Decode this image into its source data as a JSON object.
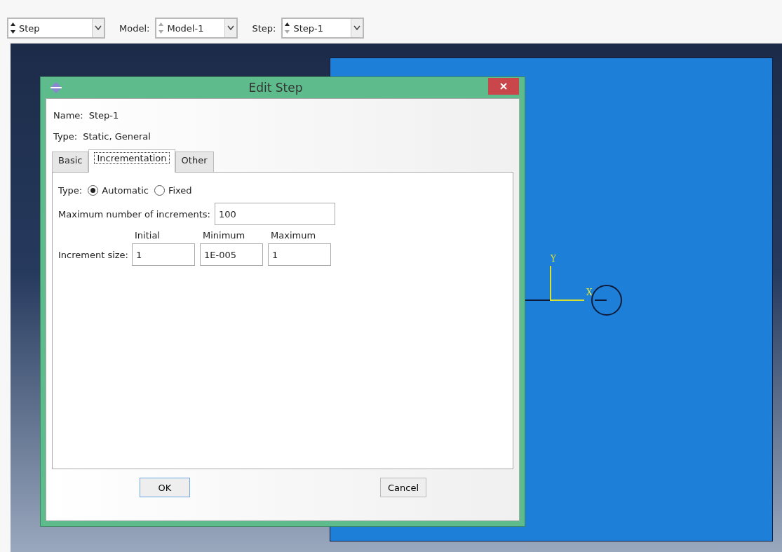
{
  "toolbar": {
    "module": "Step",
    "model_label": "Model:",
    "model": "Model-1",
    "step_label": "Step:",
    "step": "Step-1"
  },
  "viewport": {
    "axis_labels": [
      "Y",
      "X"
    ]
  },
  "dialog": {
    "title": "Edit Step",
    "name_label": "Name:",
    "name": "Step-1",
    "type_label": "Type:",
    "type": "Static, General",
    "tabs": [
      {
        "label": "Basic",
        "selected": false
      },
      {
        "label": "Incrementation",
        "selected": true
      },
      {
        "label": "Other",
        "selected": false
      }
    ],
    "incrementation_type": {
      "label": "Type:",
      "options": [
        {
          "label": "Automatic",
          "selected": true
        },
        {
          "label": "Fixed",
          "selected": false
        }
      ]
    },
    "max_increments": {
      "label": "Maximum number of increments:",
      "value": "100"
    },
    "increment_size": {
      "label": "Increment size:",
      "columns": [
        {
          "heading": "Initial",
          "value": "1"
        },
        {
          "heading": "Minimum",
          "value": "1E-005"
        },
        {
          "heading": "Maximum",
          "value": "1"
        }
      ]
    },
    "buttons": [
      "OK",
      "Cancel"
    ]
  }
}
